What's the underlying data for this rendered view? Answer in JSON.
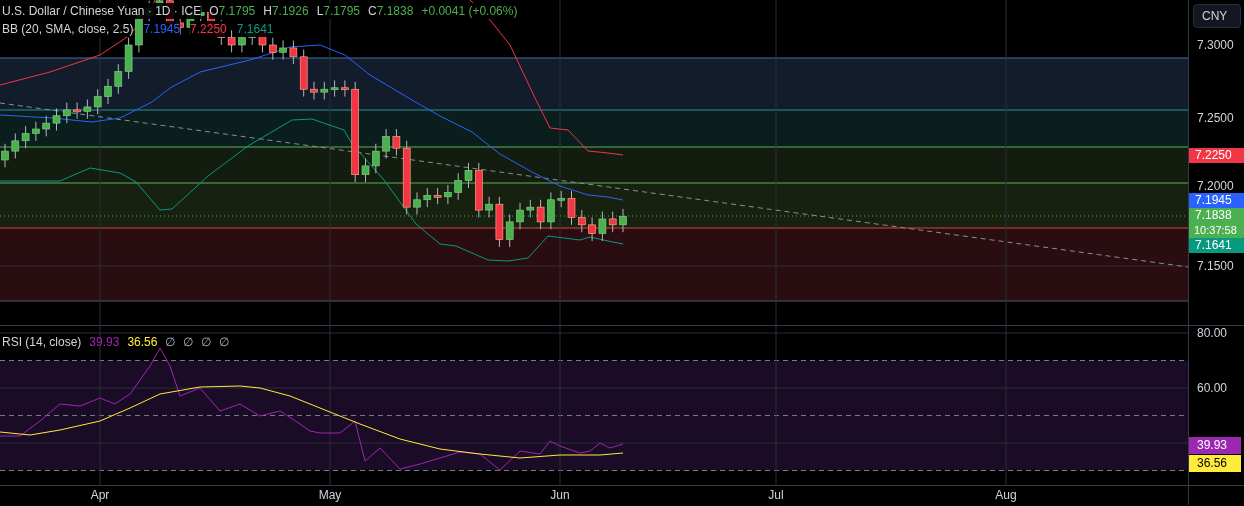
{
  "legend": {
    "symbol": "U.S. Dollar / Chinese Yuan · 1D · ICE",
    "ohlc": [
      {
        "label": "O",
        "value": "7.1795"
      },
      {
        "label": "H",
        "value": "7.1926"
      },
      {
        "label": "L",
        "value": "7.1795"
      },
      {
        "label": "C",
        "value": "7.1838"
      }
    ],
    "change": "+0.0041 (+0.06%)"
  },
  "bb_legend": {
    "name": "BB (20, SMA, close, 2.5)",
    "values": [
      {
        "text": "7.1945",
        "color": "#2962ff"
      },
      {
        "text": "7.2250",
        "color": "#f23645"
      },
      {
        "text": "7.1641",
        "color": "#089981"
      }
    ]
  },
  "currency_button": "CNY",
  "price_axis": {
    "ticks": [
      "7.3000",
      "7.2500",
      "7.2000",
      "7.1500"
    ],
    "labels": [
      {
        "text": "7.2250",
        "color": "#f23645"
      },
      {
        "text": "7.1945",
        "color": "#2962ff"
      },
      {
        "text": "7.1838",
        "countdown": "10:37:58",
        "color": "#4caf50"
      },
      {
        "text": "7.1641",
        "color": "#089981"
      }
    ]
  },
  "rsi_legend": {
    "name": "RSI (14, close)",
    "values": [
      {
        "text": "39.93",
        "color": "#9c27b0"
      },
      {
        "text": "36.56",
        "color": "#ffeb3b"
      }
    ],
    "empty_values": [
      "∅",
      "∅",
      "∅",
      "∅"
    ]
  },
  "rsi_axis": {
    "ticks": [
      "80.00",
      "60.00"
    ],
    "labels": [
      {
        "text": "39.93",
        "color": "#9c27b0"
      },
      {
        "text": "36.56",
        "color": "#ffeb3b"
      }
    ]
  },
  "time_axis": [
    "Apr",
    "May",
    "Jun",
    "Jul",
    "Aug"
  ]
}
